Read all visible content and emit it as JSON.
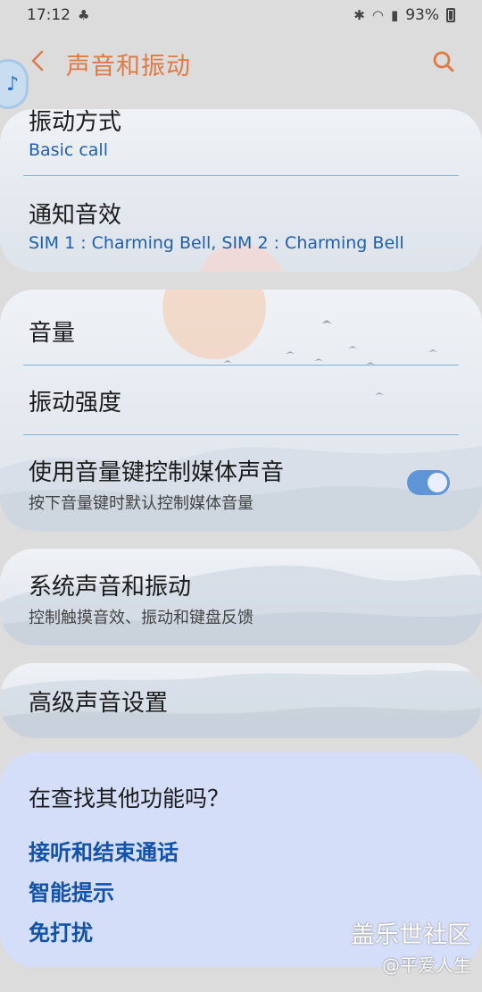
{
  "status_bar": {
    "time": "17:12",
    "battery": "93%"
  },
  "header": {
    "title": "声音和振动"
  },
  "group1": {
    "vibration_title": "振动方式",
    "vibration_value": "Basic call",
    "notification_title": "通知音效",
    "notification_value": "SIM 1 : Charming Bell, SIM 2 : Charming Bell"
  },
  "group2": {
    "volume_title": "音量",
    "vibration_intensity_title": "振动强度",
    "media_keys_title": "使用音量键控制媒体声音",
    "media_keys_desc": "按下音量键时默认控制媒体音量",
    "media_keys_on": true
  },
  "group3": {
    "system_title": "系统声音和振动",
    "system_desc": "控制触摸音效、振动和键盘反馈"
  },
  "group4": {
    "advanced_title": "高级声音设置"
  },
  "suggestions": {
    "title": "在查找其他功能吗？",
    "links": [
      "接听和结束通话",
      "智能提示",
      "免打扰"
    ]
  },
  "watermark": {
    "line1": "盖乐世社区",
    "line2": "@平爱人生"
  },
  "colors": {
    "accent": "#e07a45",
    "link": "#1252a8",
    "value": "#1f5fb0",
    "toggle": "#5f95d6"
  }
}
